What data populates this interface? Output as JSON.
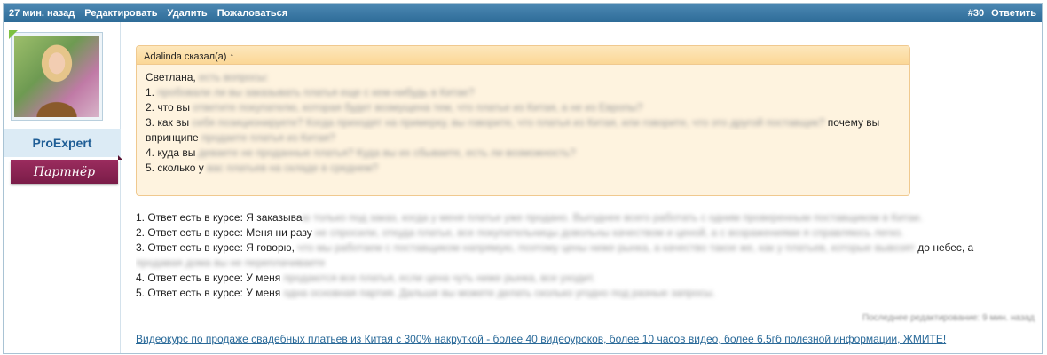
{
  "topbar": {
    "time": "27 мин. назад",
    "edit": "Редактировать",
    "delete": "Удалить",
    "report": "Пожаловаться",
    "post_number": "#30",
    "reply": "Ответить"
  },
  "author": {
    "username": "ProExpert",
    "rank": "Партнёр"
  },
  "quote": {
    "header": "Adalinda сказал(а) ↑",
    "lines": [
      {
        "visible": "Светлана, ",
        "blurred": "есть вопросы:",
        "tail": ""
      },
      {
        "visible": "1. ",
        "blurred": "пробовали ли вы заказывать платья еще с кем-нибудь в Китае?",
        "tail": ""
      },
      {
        "visible": "2. что вы ",
        "blurred": "ответите покупателю, которая будет возмущена тем, что платье из Китая, а не из Европы?",
        "tail": ""
      },
      {
        "visible": "3. как вы ",
        "blurred": "себя позиционируете? Когда приходят на примерку, вы говорите, что платья из Китая, или говорите, что это другой поставщик?",
        "tail": " почему вы"
      },
      {
        "visible": "впринципе ",
        "blurred": "продаете платья из Китая?",
        "tail": ""
      },
      {
        "visible": "4. куда вы ",
        "blurred": "деваете не проданные платья? Куда вы их сбываете, есть ли возможность?",
        "tail": ""
      },
      {
        "visible": "5. сколько у ",
        "blurred": "вас платьев на складе в среднем?",
        "tail": ""
      }
    ]
  },
  "answers": [
    {
      "visible": "1. Ответ есть в курсе: Я заказыва",
      "blurred": "ю только под заказ, когда у меня платье уже продано. Выгоднее всего работать с одним проверенным поставщиком в Китае.",
      "tail": ""
    },
    {
      "visible": "2. Ответ есть в курсе: Меня ни разу ",
      "blurred": "не спросили, откуда платье, все покупательницы довольны качеством и ценой, а с возражениями я справляюсь легко.",
      "tail": ""
    },
    {
      "visible": "3. Ответ есть в курсе: Я говорю, ",
      "blurred": "что мы работаем с поставщиком напрямую, поэтому цены ниже рынка, а качество такое же, как у платьев, которые вывозят",
      "tail": " до небес, а"
    },
    {
      "visible": "",
      "blurred": "продавая дома вы не переплачиваете",
      "tail": ""
    },
    {
      "visible": "4. Ответ есть в курсе: У меня ",
      "blurred": "продаются все платья, если цена чуть ниже рынка, все уходит.",
      "tail": ""
    },
    {
      "visible": "5. Ответ есть в курсе: У меня ",
      "blurred": "одна основная партия. Дальше вы можете делать сколько угодно под разные запросы.",
      "tail": ""
    }
  ],
  "edited": "Последнее редактирование: 9 мин. назад",
  "signature": "Видеокурс по продаже свадебных платьев из Китая с 300% накруткой - более 40 видеоуроков, более 10 часов видео, более 6.5гб полезной информации, ЖМИТЕ!"
}
